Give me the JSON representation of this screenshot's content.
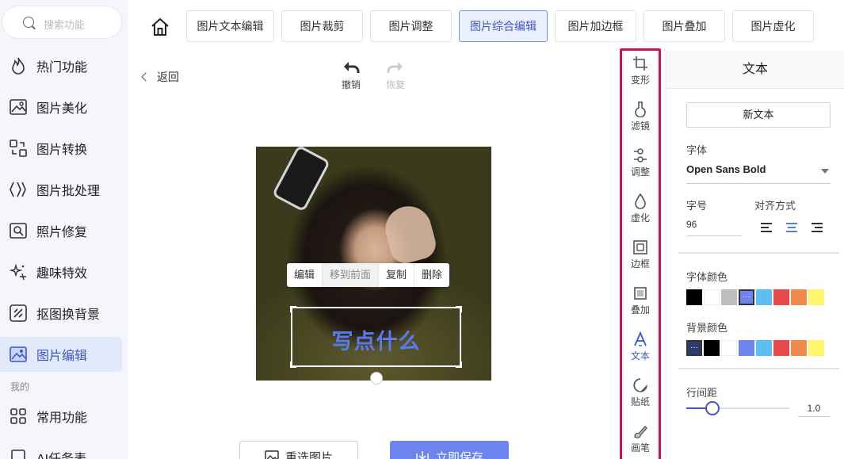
{
  "sidebar": {
    "search_placeholder": "搜索功能",
    "items": [
      {
        "label": "热门功能",
        "icon": "fire-icon"
      },
      {
        "label": "图片美化",
        "icon": "image-beautify-icon"
      },
      {
        "label": "图片转换",
        "icon": "convert-icon"
      },
      {
        "label": "图片批处理",
        "icon": "batch-icon"
      },
      {
        "label": "照片修复",
        "icon": "repair-icon"
      },
      {
        "label": "趣味特效",
        "icon": "sparkle-icon"
      },
      {
        "label": "抠图换背景",
        "icon": "cutout-icon"
      },
      {
        "label": "图片编辑",
        "icon": "image-edit-icon",
        "active": true
      }
    ],
    "section_mine": "我的",
    "mine_items": [
      {
        "label": "常用功能",
        "icon": "grid-icon"
      },
      {
        "label": "AI任务表",
        "icon": "ai-task-icon"
      }
    ]
  },
  "tabs": [
    {
      "label": "图片文本编辑"
    },
    {
      "label": "图片裁剪"
    },
    {
      "label": "图片调整"
    },
    {
      "label": "图片综合编辑",
      "active": true
    },
    {
      "label": "图片加边框"
    },
    {
      "label": "图片叠加"
    },
    {
      "label": "图片虚化"
    }
  ],
  "toolbar": {
    "back_label": "返回",
    "undo_label": "撤销",
    "redo_label": "恢复"
  },
  "context_menu": {
    "edit": "编辑",
    "bring_front": "移到前面",
    "copy": "复制",
    "delete": "删除"
  },
  "canvas": {
    "text_layer": "写点什么"
  },
  "actions": {
    "reselect_label": "重选图片",
    "save_label": "立即保存"
  },
  "tools": [
    {
      "label": "变形",
      "icon": "crop-icon"
    },
    {
      "label": "滤镜",
      "icon": "filter-icon"
    },
    {
      "label": "调整",
      "icon": "adjust-icon"
    },
    {
      "label": "虚化",
      "icon": "blur-drop-icon"
    },
    {
      "label": "边框",
      "icon": "frame-icon"
    },
    {
      "label": "叠加",
      "icon": "overlay-icon"
    },
    {
      "label": "文本",
      "icon": "text-icon",
      "active": true
    },
    {
      "label": "贴纸",
      "icon": "sticker-icon"
    },
    {
      "label": "画笔",
      "icon": "brush-icon"
    }
  ],
  "panel": {
    "title": "文本",
    "new_text_label": "新文本",
    "font_label": "字体",
    "font_value": "Open Sans Bold",
    "size_label": "字号",
    "size_value": "96",
    "align_label": "对齐方式",
    "align_selected": "center",
    "font_color_label": "字体颜色",
    "font_colors": [
      "#000000",
      "#ffffff",
      "#bdbdbd",
      "#6d84ef",
      "#5bc0f0",
      "#e64a4a",
      "#f08a4b",
      "#fff46b"
    ],
    "font_color_selected_index": 3,
    "bg_color_label": "背景颜色",
    "bg_colors": [
      "#2d3a6b",
      "#000000",
      "#ffffff",
      "#6d84ef",
      "#5bc0f0",
      "#e64a4a",
      "#f08a4b",
      "#fff46b"
    ],
    "bg_color_selected_index": 0,
    "line_height_label": "行间距",
    "line_height_value": "1.0",
    "line_height_fraction": 0.25
  },
  "colors": {
    "accent": "#3d56c9",
    "highlight_border": "#c8184a",
    "save_button": "#6d84ef"
  }
}
